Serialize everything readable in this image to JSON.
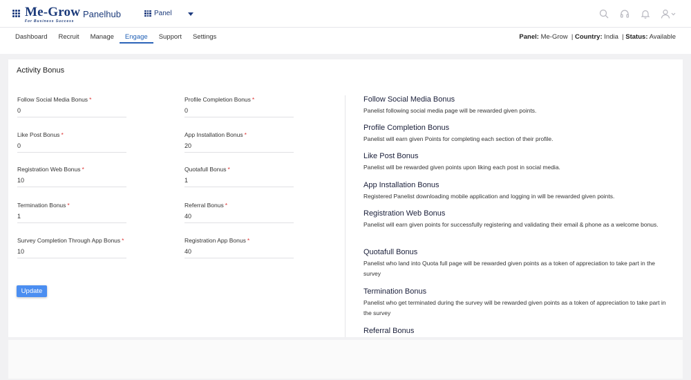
{
  "header": {
    "logo_main": "Me-Grow",
    "logo_tag": "For Business Success",
    "app_name": "Panelhub",
    "panel_switch": "Panel"
  },
  "nav": {
    "tabs": [
      {
        "label": "Dashboard"
      },
      {
        "label": "Recruit"
      },
      {
        "label": "Manage"
      },
      {
        "label": "Engage"
      },
      {
        "label": "Support"
      },
      {
        "label": "Settings"
      }
    ],
    "active_tab": "Engage"
  },
  "panel_info": {
    "panel_label": "Panel",
    "panel_value": "Me-Grow",
    "country_label": "Country",
    "country_value": "India",
    "status_label": "Status",
    "status_value": "Available"
  },
  "form": {
    "title": "Activity Bonus",
    "fields": [
      {
        "label": "Follow Social Media Bonus",
        "value": "0"
      },
      {
        "label": "Profile Completion Bonus",
        "value": "0"
      },
      {
        "label": "Like Post Bonus",
        "value": "0"
      },
      {
        "label": "App Installation Bonus",
        "value": "20"
      },
      {
        "label": "Registration Web Bonus",
        "value": "10"
      },
      {
        "label": "Quotafull Bonus",
        "value": "1"
      },
      {
        "label": "Termination Bonus",
        "value": "1"
      },
      {
        "label": "Referral Bonus",
        "value": "40"
      },
      {
        "label": "Survey Completion Through App Bonus",
        "value": "10"
      },
      {
        "label": "Registration App Bonus",
        "value": "40"
      }
    ],
    "required_mark": "*",
    "update_label": "Update"
  },
  "descriptions": [
    {
      "title": "Follow Social Media Bonus",
      "text": "Panelist following social media page will be rewarded given points."
    },
    {
      "title": "Profile Completion Bonus",
      "text": "Panelist will earn given Points for completing each section of their profile."
    },
    {
      "title": "Like Post Bonus",
      "text": "Panelist will be rewarded given points upon liking each post in social media."
    },
    {
      "title": "App Installation Bonus",
      "text": "Registered Panelist downloading mobile application and logging in will be rewarded given points."
    },
    {
      "title": "Registration Web Bonus",
      "text": "Panelist will earn given points for successfully registering and validating their email & phone as a welcome bonus."
    },
    {
      "title": "Quotafull Bonus",
      "text": "Panelist who land into Quota full page will be rewarded given points as a token of appreciation to take part in the survey"
    },
    {
      "title": "Termination Bonus",
      "text": "Panelist who get terminated during the survey will be rewarded given points as a token of appreciation to take part in the survey"
    },
    {
      "title": "Referral Bonus",
      "text": ""
    }
  ],
  "colors": {
    "brand": "#1b3a7a",
    "accent": "#4b8ef1",
    "required": "#dd3333"
  }
}
